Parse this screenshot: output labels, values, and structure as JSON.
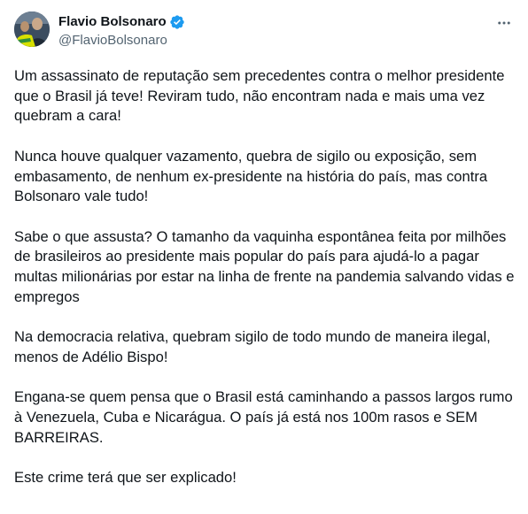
{
  "author": {
    "display_name": "Flavio Bolsonaro",
    "handle": "@FlavioBolsonaro",
    "verified": true,
    "verified_color": "#1d9bf0"
  },
  "icons": {
    "more": "more-horizontal-icon",
    "verified": "verified-badge-icon"
  },
  "tweet": {
    "paragraphs": [
      "Um assassinato de reputação sem precedentes contra o melhor presidente que o Brasil já teve! Reviram tudo, não encontram nada e mais uma vez quebram a cara!",
      "Nunca houve qualquer vazamento, quebra de sigilo ou exposição, sem embasamento, de nenhum ex-presidente na história do país, mas contra Bolsonaro vale tudo!",
      "Sabe o que assusta? O tamanho da vaquinha espontânea feita por milhões de brasileiros ao presidente mais popular do país para ajudá-lo a pagar multas milionárias por estar na linha de frente na pandemia salvando vidas e empregos",
      "Na democracia relativa, quebram sigilo de todo mundo de maneira ilegal, menos de Adélio Bispo!",
      "Engana-se quem pensa que o Brasil está caminhando a passos largos rumo à Venezuela, Cuba e Nicarágua. O país já está nos 100m rasos e SEM BARREIRAS.",
      "Este crime terá que ser explicado!"
    ]
  },
  "colors": {
    "text_primary": "#0f1419",
    "text_secondary": "#536471",
    "accent": "#1d9bf0"
  }
}
